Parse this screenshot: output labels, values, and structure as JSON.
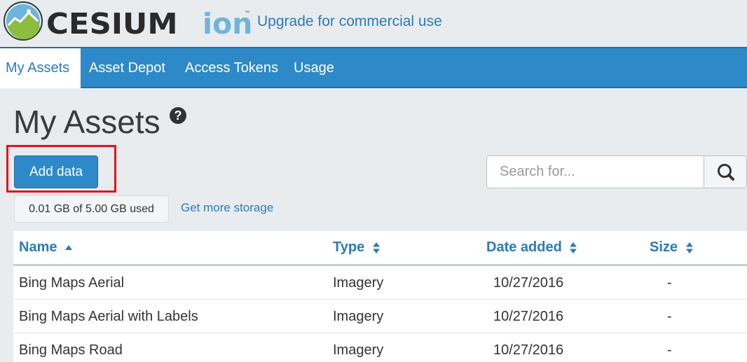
{
  "header": {
    "brand": "CESIUM",
    "brand_suffix": "ion",
    "trademark": "™",
    "upgrade_link": "Upgrade for commercial use"
  },
  "nav": {
    "tabs": [
      {
        "label": "My Assets",
        "active": true
      },
      {
        "label": "Asset Depot",
        "active": false
      },
      {
        "label": "Access Tokens",
        "active": false
      },
      {
        "label": "Usage",
        "active": false
      }
    ]
  },
  "page": {
    "title": "My Assets",
    "help_icon": "question-circle-icon",
    "add_button": "Add data",
    "search_placeholder": "Search for...",
    "search_icon": "magnifier-icon",
    "storage_used": "0.01 GB of 5.00 GB used",
    "storage_link": "Get more storage"
  },
  "table": {
    "columns": [
      {
        "label": "Name",
        "sort": "ascending"
      },
      {
        "label": "Type",
        "sort": "both"
      },
      {
        "label": "Date added",
        "sort": "both"
      },
      {
        "label": "Size",
        "sort": "both"
      }
    ],
    "rows": [
      {
        "name": "Bing Maps Aerial",
        "type": "Imagery",
        "date": "10/27/2016",
        "size": "-"
      },
      {
        "name": "Bing Maps Aerial with Labels",
        "type": "Imagery",
        "date": "10/27/2016",
        "size": "-"
      },
      {
        "name": "Bing Maps Road",
        "type": "Imagery",
        "date": "10/27/2016",
        "size": "-"
      }
    ]
  },
  "colors": {
    "accent": "#2d89c8",
    "link": "#2b7bb9",
    "highlight": "#e0151b",
    "background": "#e8ecef"
  }
}
